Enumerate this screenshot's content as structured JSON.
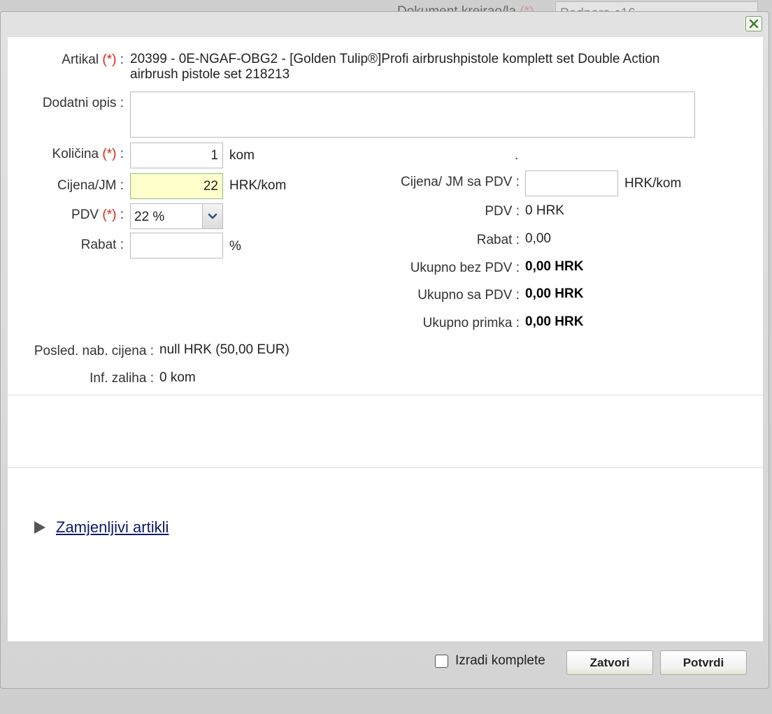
{
  "background": {
    "label": "Dokument kreirao/la",
    "required": "(*)",
    "value": "Podpora c16"
  },
  "form": {
    "required_mark": "(*)",
    "artikal": {
      "label": "Artikal",
      "value": "20399 - 0E-NGAF-OBG2 - [Golden Tulip®]Profi airbrushpistole komplett set Double Action airbrush pistole set 218213"
    },
    "dodatni_opis": {
      "label": "Dodatni opis :",
      "value": ""
    },
    "kolicina": {
      "label": "Količina",
      "value": "1",
      "unit": "kom"
    },
    "cijena_jm": {
      "label": "Cijena/JM :",
      "value": "22",
      "unit": "HRK/kom"
    },
    "pdv": {
      "label": "PDV",
      "value": "22 %"
    },
    "rabat": {
      "label": "Rabat :",
      "value": "",
      "unit": "%"
    },
    "posled_nab_cijena": {
      "label": "Posled. nab. cijena :",
      "value": "null HRK (50,00 EUR)"
    },
    "inf_zaliha": {
      "label": "Inf. zaliha :",
      "value": "0 kom"
    }
  },
  "summary": {
    "dot": ".",
    "cijena_sa_pdv": {
      "label": "Cijena/ JM sa PDV :",
      "value": "",
      "unit": "HRK/kom"
    },
    "pdv": {
      "label": "PDV :",
      "value": "0 HRK"
    },
    "rabat": {
      "label": "Rabat :",
      "value": "0,00"
    },
    "ukupno_bez_pdv": {
      "label": "Ukupno bez PDV :",
      "value": "0,00 HRK"
    },
    "ukupno_sa_pdv": {
      "label": "Ukupno sa PDV :",
      "value": "0,00 HRK"
    },
    "ukupno_primka": {
      "label": "Ukupno primka :",
      "value": "0,00 HRK"
    }
  },
  "zamjenljivi": {
    "label": "Zamjenljivi artikli"
  },
  "footer": {
    "izradi_komplete": "Izradi komplete",
    "zatvori": "Zatvori",
    "potvrdi": "Potvrdi"
  },
  "colors": {
    "required": "#d21111",
    "link": "#0b1a66",
    "highlight_input": "#ffffcc"
  },
  "icons": {
    "close": "close-icon",
    "dropdown": "chevron-down-icon",
    "expander": "triangle-right-icon"
  }
}
